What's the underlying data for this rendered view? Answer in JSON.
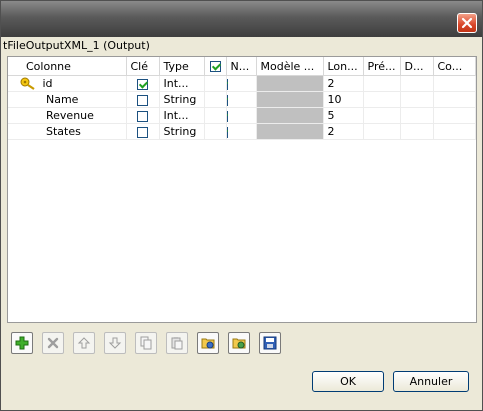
{
  "dialog": {
    "subtitle": "tFileOutputXML_1 (Output)"
  },
  "table": {
    "columns": [
      "Colonne",
      "Clé",
      "Type",
      "",
      "N...",
      "Modèle ...",
      "Lon...",
      "Pré...",
      "D...",
      "Co..."
    ],
    "header_checkbox_checked": true,
    "rows": [
      {
        "name": "id",
        "key": true,
        "type": "Int...",
        "nullable": true,
        "length": "2"
      },
      {
        "name": "Name",
        "key": false,
        "type": "String",
        "nullable": true,
        "length": "10"
      },
      {
        "name": "Revenue",
        "key": false,
        "type": "Int...",
        "nullable": true,
        "length": "5"
      },
      {
        "name": "States",
        "key": false,
        "type": "String",
        "nullable": true,
        "length": "2"
      }
    ]
  },
  "toolbar": {
    "icons": [
      "add-icon",
      "remove-icon",
      "move-up-icon",
      "move-down-icon",
      "copy-icon",
      "paste-icon",
      "import-icon",
      "export-icon",
      "save-icon"
    ]
  },
  "buttons": {
    "ok": "OK",
    "cancel": "Annuler"
  },
  "colors": {
    "key_icon": "#e0b400",
    "check_green": "#21a121",
    "close_red": "#d8462a"
  }
}
